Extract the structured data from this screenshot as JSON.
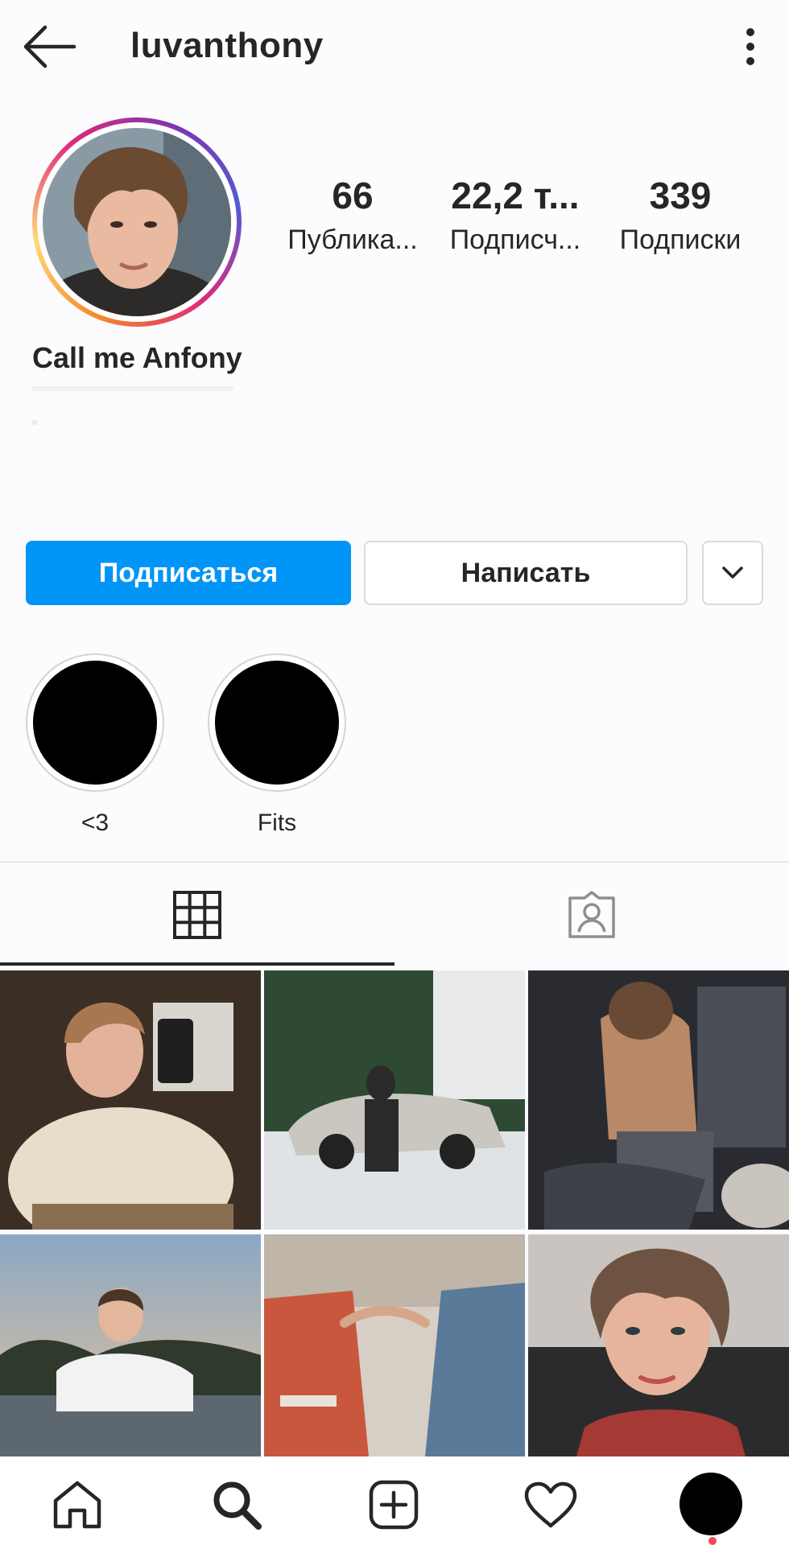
{
  "header": {
    "username": "luvanthony",
    "back_icon": "arrow-left-icon",
    "more_icon": "more-vertical-icon"
  },
  "profile": {
    "display_name": "Call me Anfony",
    "avatar": "profile-photo"
  },
  "stats": [
    {
      "value": "66",
      "label": "Публика..."
    },
    {
      "value": "22,2 т...",
      "label": "Подписч..."
    },
    {
      "value": "339",
      "label": "Подписки"
    }
  ],
  "actions": {
    "follow_label": "Подписаться",
    "message_label": "Написать",
    "dropdown_icon": "chevron-down-icon"
  },
  "highlights": [
    {
      "label": "<3"
    },
    {
      "label": "Fits"
    }
  ],
  "tabs": [
    {
      "icon": "grid-icon",
      "active": true
    },
    {
      "icon": "tagged-person-icon",
      "active": false
    }
  ],
  "posts_count_visible": 6,
  "bottom_nav": [
    "home-icon",
    "search-icon",
    "add-post-icon",
    "heart-icon",
    "profile-avatar"
  ],
  "colors": {
    "accent": "#0095f6",
    "text": "#262626",
    "border": "#dbdbdb",
    "notification": "#ed4956"
  }
}
